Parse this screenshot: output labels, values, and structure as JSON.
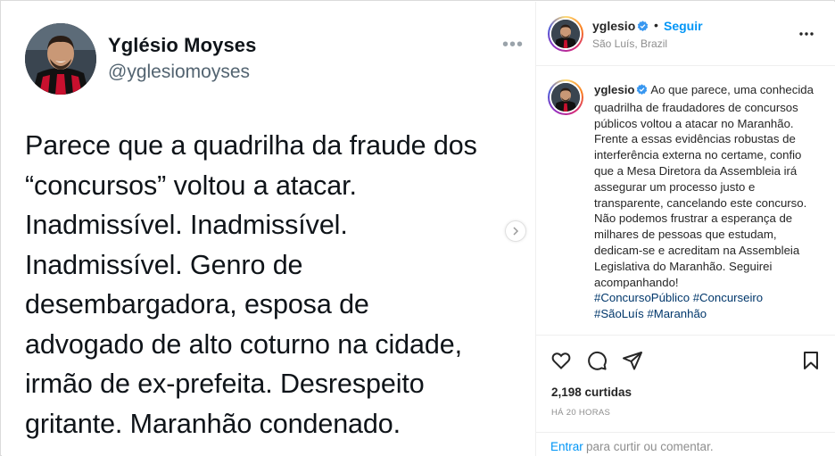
{
  "tweet": {
    "name": "Yglésio Moyses",
    "handle": "@yglesiomoyses",
    "text": "Parece que a quadrilha da fraude dos\n“concursos” voltou a atacar.\nInadmissível. Inadmissível.\nInadmissível. Genro de\ndesembargadora, esposa de\nadvogado de alto coturno na cidade,\nirmão de ex-prefeita. Desrespeito\ngritante. Maranhão condenado."
  },
  "post": {
    "username": "yglesio",
    "follow_label": "Seguir",
    "location": "São Luís, Brazil",
    "caption_username": "yglesio",
    "caption": " Ao que parece, uma conhecida quadrilha de fraudadores de concursos públicos voltou a atacar no Maranhão. Frente a essas evidências robustas de interferência externa no certame, confio que a Mesa Diretora da Assembleia irá assegurar um processo justo e transparente, cancelando este concurso. Não podemos frustrar a esperança de milhares de pessoas que estudam, dedicam-se e acreditam na Assembleia Legislativa do Maranhão. Seguirei acompanhando!",
    "hashtags": [
      "#ConcursoPúblico",
      "#Concurseiro",
      "#SãoLuís",
      "#Maranhão"
    ],
    "likes": "2,198 curtidas",
    "time": "HÁ 20 HORAS",
    "comment_login": "Entrar",
    "comment_rest": "para curtir ou comentar."
  },
  "icons": {
    "more": "more-horizontal-icon",
    "verified": "verified-badge-icon",
    "like": "heart-icon",
    "comment": "comment-icon",
    "share": "send-icon",
    "save": "bookmark-icon",
    "next": "chevron-right-icon"
  },
  "colors": {
    "link_blue": "#0095f6",
    "hashtag": "#00376b",
    "verified_blue": "#3897f0",
    "jersey_red": "#c8102e",
    "jersey_black": "#111111"
  }
}
